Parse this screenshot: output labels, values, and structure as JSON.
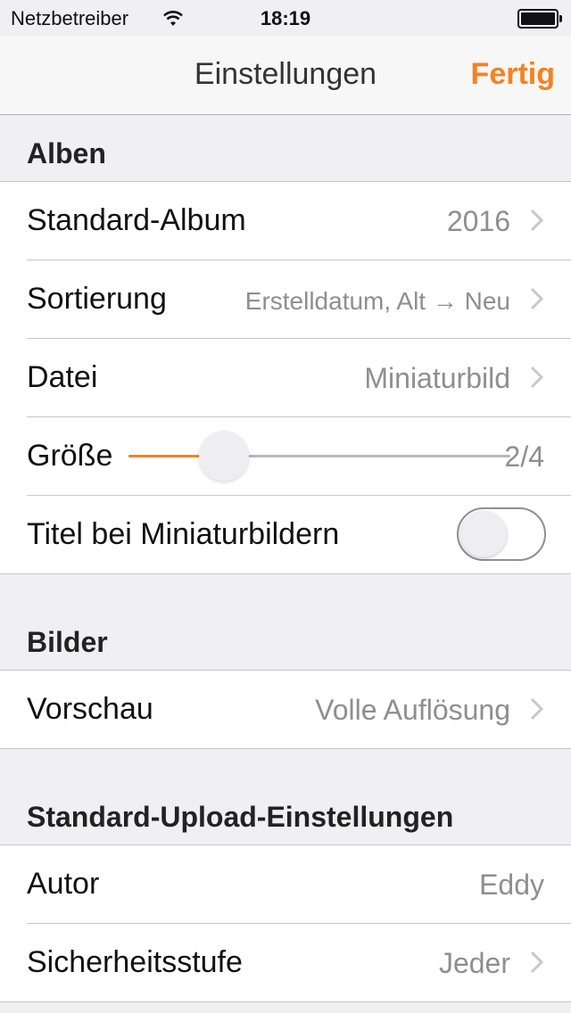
{
  "status_bar": {
    "carrier": "Netzbetreiber",
    "time": "18:19"
  },
  "nav": {
    "title": "Einstellungen",
    "done_label": "Fertig"
  },
  "sections": {
    "alben": {
      "header": "Alben",
      "standard_album": {
        "label": "Standard-Album",
        "value": "2016"
      },
      "sortierung": {
        "label": "Sortierung",
        "value": "Erstelldatum, Alt → Neu"
      },
      "datei": {
        "label": "Datei",
        "value": "Miniaturbild"
      },
      "groesse": {
        "label": "Größe",
        "value": "2/4",
        "level": 0.25
      },
      "titel": {
        "label": "Titel bei Miniaturbildern",
        "enabled": false
      }
    },
    "bilder": {
      "header": "Bilder",
      "vorschau": {
        "label": "Vorschau",
        "value": "Volle Auflösung"
      }
    },
    "upload": {
      "header": "Standard-Upload-Einstellungen",
      "autor": {
        "label": "Autor",
        "value": "Eddy"
      },
      "sicherheit": {
        "label": "Sicherheitsstufe",
        "value": "Jeder"
      }
    }
  },
  "colors": {
    "accent": "#f58220",
    "background": "#efeff4"
  }
}
